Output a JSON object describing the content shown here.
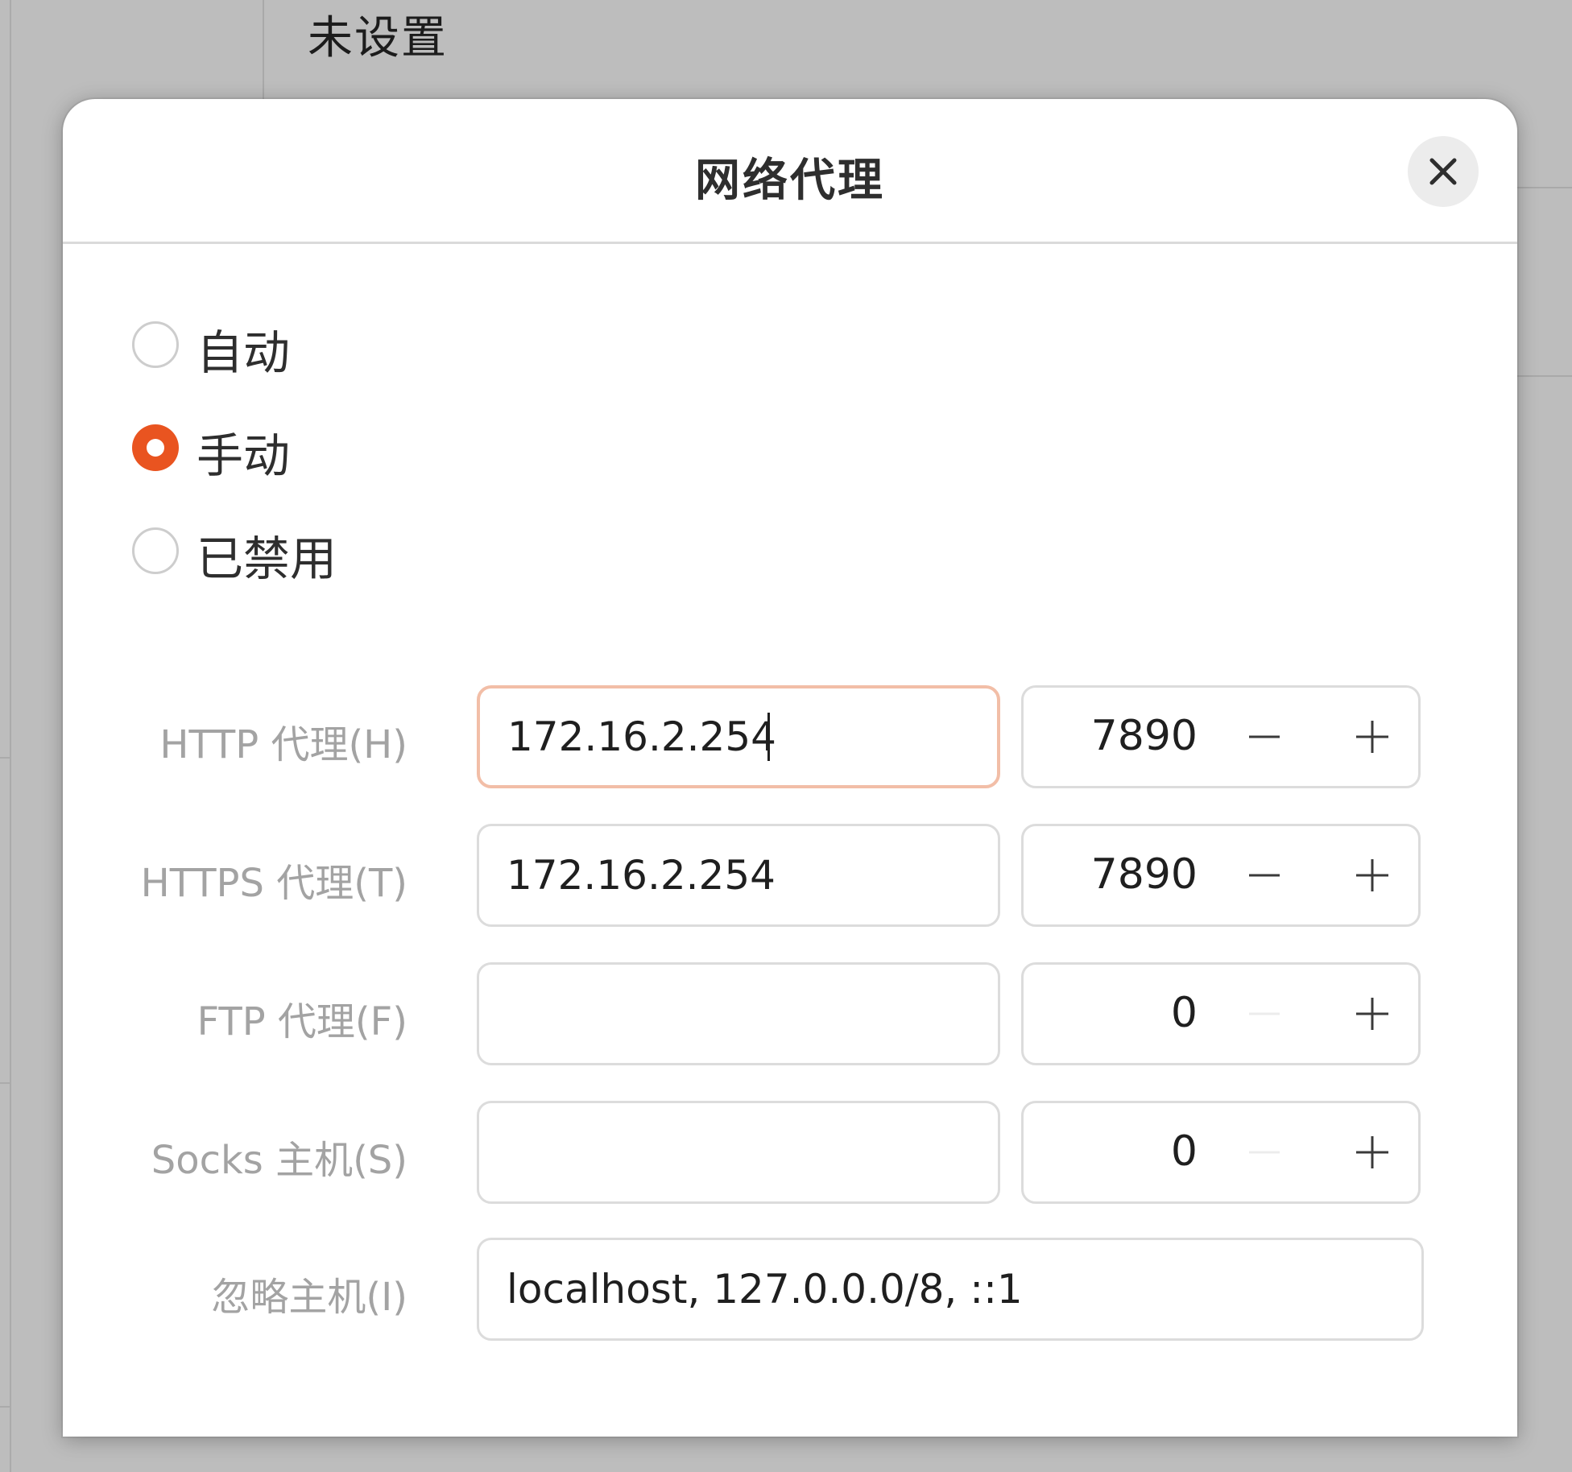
{
  "background": {
    "title": "未设置"
  },
  "dialog": {
    "title": "网络代理",
    "close_icon": "close-icon"
  },
  "proxy_mode": {
    "selected": "手动",
    "options": [
      {
        "label": "自动",
        "checked": false
      },
      {
        "label": "手动",
        "checked": true
      },
      {
        "label": "已禁用",
        "checked": false
      }
    ]
  },
  "proxies": {
    "http": {
      "label": "HTTP 代理(H)",
      "host": "172.16.2.254",
      "port": "7890"
    },
    "https": {
      "label": "HTTPS 代理(T)",
      "host": "172.16.2.254",
      "port": "7890"
    },
    "ftp": {
      "label": "FTP 代理(F)",
      "host": "",
      "port": "0"
    },
    "socks": {
      "label": "Socks 主机(S)",
      "host": "",
      "port": "0"
    }
  },
  "ignore_hosts": {
    "label": "忽略主机(I)",
    "value": "localhost, 127.0.0.0/8, ::1"
  },
  "colors": {
    "accent": "#e95420",
    "focus_border": "#f2bea7"
  }
}
